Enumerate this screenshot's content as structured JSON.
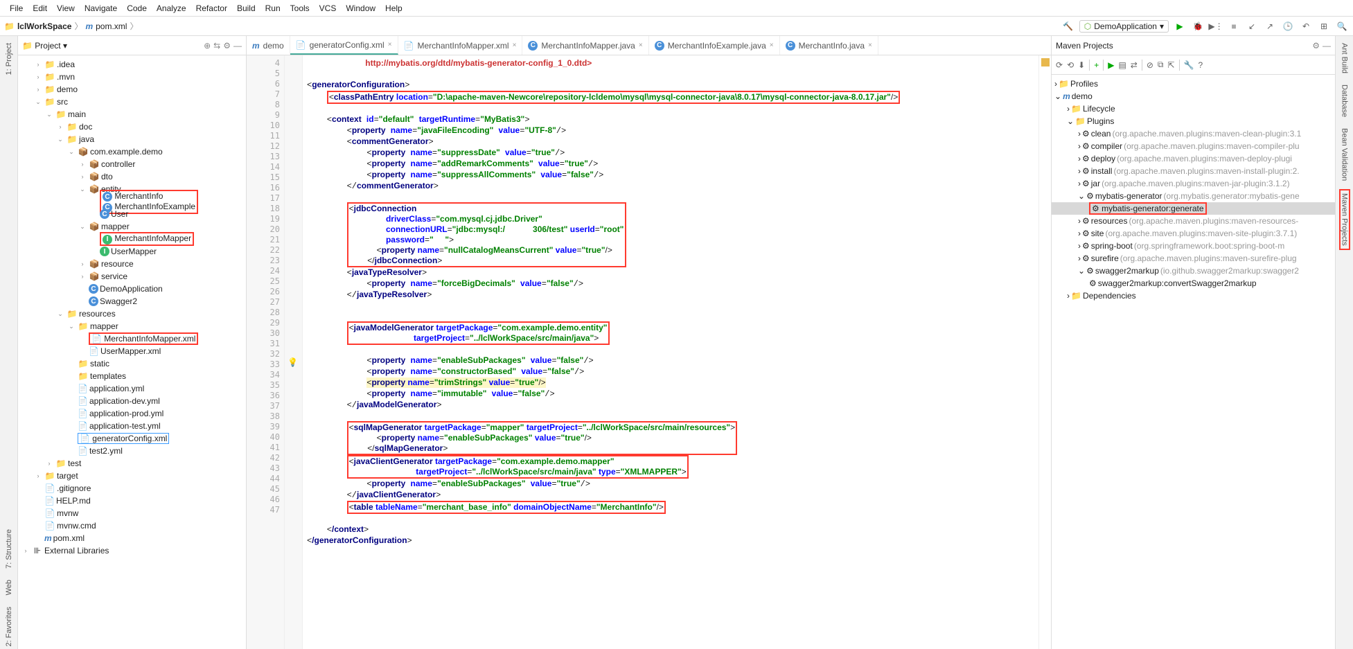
{
  "menu": [
    "File",
    "Edit",
    "View",
    "Navigate",
    "Code",
    "Analyze",
    "Refactor",
    "Build",
    "Run",
    "Tools",
    "VCS",
    "Window",
    "Help"
  ],
  "breadcrumb": {
    "root": "lclWorkSpace",
    "file": "pom.xml"
  },
  "run_config": "DemoApplication",
  "left_tabs": {
    "project": "1: Project",
    "favorites": "2: Favorites",
    "structure": "7: Structure",
    "web": "Web"
  },
  "right_tabs": {
    "ant": "Ant Build",
    "database": "Database",
    "bean": "Bean Validation",
    "maven": "Maven Projects"
  },
  "project_panel": {
    "title": "Project"
  },
  "tree": {
    "idea": ".idea",
    "mvn": ".mvn",
    "demo": "demo",
    "src": "src",
    "main": "main",
    "doc": "doc",
    "java": "java",
    "pkg": "com.example.demo",
    "controller": "controller",
    "dto": "dto",
    "entity": "entity",
    "merchantInfo": "MerchantInfo",
    "merchantInfoExample": "MerchantInfoExample",
    "user": "User",
    "mapper": "mapper",
    "merchantInfoMapper": "MerchantInfoMapper",
    "userMapper": "UserMapper",
    "resource": "resource",
    "service": "service",
    "demoApp": "DemoApplication",
    "swagger": "Swagger2",
    "resources": "resources",
    "mapperDir": "mapper",
    "merchantInfoMapperXml": "MerchantInfoMapper.xml",
    "userMapperXml": "UserMapper.xml",
    "static": "static",
    "templates": "templates",
    "appYml": "application.yml",
    "appDevYml": "application-dev.yml",
    "appProdYml": "application-prod.yml",
    "appTestYml": "application-test.yml",
    "generatorConfig": "generatorConfig.xml",
    "test2Yml": "test2.yml",
    "test": "test",
    "target": "target",
    "gitignore": ".gitignore",
    "help": "HELP.md",
    "mvnw": "mvnw",
    "mvnwCmd": "mvnw.cmd",
    "pom": "pom.xml",
    "extLib": "External Libraries"
  },
  "tabs": [
    {
      "icon": "m",
      "label": "demo",
      "active": false
    },
    {
      "icon": "x",
      "label": "generatorConfig.xml",
      "active": true
    },
    {
      "icon": "x",
      "label": "MerchantInfoMapper.xml",
      "active": false
    },
    {
      "icon": "c",
      "label": "MerchantInfoMapper.java",
      "active": false
    },
    {
      "icon": "c",
      "label": "MerchantInfoExample.java",
      "active": false
    },
    {
      "icon": "c",
      "label": "MerchantInfo.java",
      "active": false
    }
  ],
  "lines_start": 4,
  "lines_end": 47,
  "code": {
    "l4": "        \"http://mybatis.org/dtd/mybatis-generator-config_1_0.dtd\">",
    "l6a": "generatorConfiguration",
    "l7a": "classPathEntry",
    "l7b": "location",
    "l7v": "D:\\apache-maven-Newcore\\repository-lcldemo\\mysql\\mysql-connector-java\\8.0.17\\mysql-connector-java-8.0.17.jar",
    "l9a": "context",
    "l9b": "id",
    "l9bv": "default",
    "l9c": "targetRuntime",
    "l9cv": "MyBatis3",
    "l10": "property",
    "l10n": "javaFileEncoding",
    "l10v": "UTF-8",
    "l11": "commentGenerator",
    "l12n": "suppressDate",
    "l12v": "true",
    "l13n": "addRemarkComments",
    "l13v": "true",
    "l14n": "suppressAllComments",
    "l14v": "false",
    "l17": "jdbcConnection",
    "l18a": "driverClass",
    "l18v": "com.mysql.cj.jdbc.Driver",
    "l19a": "connectionURL",
    "l19v": "jdbc:mysql:/",
    "l19v2": "306/test",
    "l19b": "userId",
    "l19bv": "root",
    "l20a": "password",
    "l21n": "nullCatalogMeansCurrent",
    "l21v": "true",
    "l23": "javaTypeResolver",
    "l24n": "forceBigDecimals",
    "l24v": "false",
    "l28": "javaModelGenerator",
    "l28a": "targetPackage",
    "l28v": "com.example.demo.entity",
    "l29a": "targetProject",
    "l29v": "../lclWorkSpace/src/main/java",
    "l31n": "enableSubPackages",
    "l31v": "false",
    "l32n": "constructorBased",
    "l32v": "false",
    "l33n": "trimStrings",
    "l33v": "true",
    "l34n": "immutable",
    "l34v": "false",
    "l37": "sqlMapGenerator",
    "l37a": "targetPackage",
    "l37v": "mapper",
    "l37b": "targetProject",
    "l37bv": "../lclWorkSpace/src/main/resources",
    "l38n": "enableSubPackages",
    "l38v": "true",
    "l40": "javaClientGenerator",
    "l40a": "targetPackage",
    "l40v": "com.example.demo.mapper",
    "l41a": "targetProject",
    "l41v": "../lclWorkSpace/src/main/java",
    "l41b": "type",
    "l41bv": "XMLMAPPER",
    "l42n": "enableSubPackages",
    "l42v": "true",
    "l44": "table",
    "l44a": "tableName",
    "l44v": "merchant_base_info",
    "l44b": "domainObjectName",
    "l44bv": "MerchantInfo",
    "l46": "/context",
    "l47": "/generatorConfiguration"
  },
  "maven": {
    "title": "Maven Projects",
    "profiles": "Profiles",
    "demo": "demo",
    "lifecycle": "Lifecycle",
    "plugins": "Plugins",
    "items": [
      {
        "name": "clean",
        "desc": "(org.apache.maven.plugins:maven-clean-plugin:3.1"
      },
      {
        "name": "compiler",
        "desc": "(org.apache.maven.plugins:maven-compiler-plu"
      },
      {
        "name": "deploy",
        "desc": "(org.apache.maven.plugins:maven-deploy-plugi"
      },
      {
        "name": "install",
        "desc": "(org.apache.maven.plugins:maven-install-plugin:2."
      },
      {
        "name": "jar",
        "desc": "(org.apache.maven.plugins:maven-jar-plugin:3.1.2)"
      },
      {
        "name": "mybatis-generator",
        "desc": "(org.mybatis.generator:mybatis-gene"
      },
      {
        "name": "resources",
        "desc": "(org.apache.maven.plugins:maven-resources-"
      },
      {
        "name": "site",
        "desc": "(org.apache.maven.plugins:maven-site-plugin:3.7.1)"
      },
      {
        "name": "spring-boot",
        "desc": "(org.springframework.boot:spring-boot-m"
      },
      {
        "name": "surefire",
        "desc": "(org.apache.maven.plugins:maven-surefire-plug"
      },
      {
        "name": "swagger2markup",
        "desc": "(io.github.swagger2markup:swagger2"
      }
    ],
    "mybatisGen": "mybatis-generator:generate",
    "swaggerTask": "swagger2markup:convertSwagger2markup",
    "deps": "Dependencies"
  }
}
